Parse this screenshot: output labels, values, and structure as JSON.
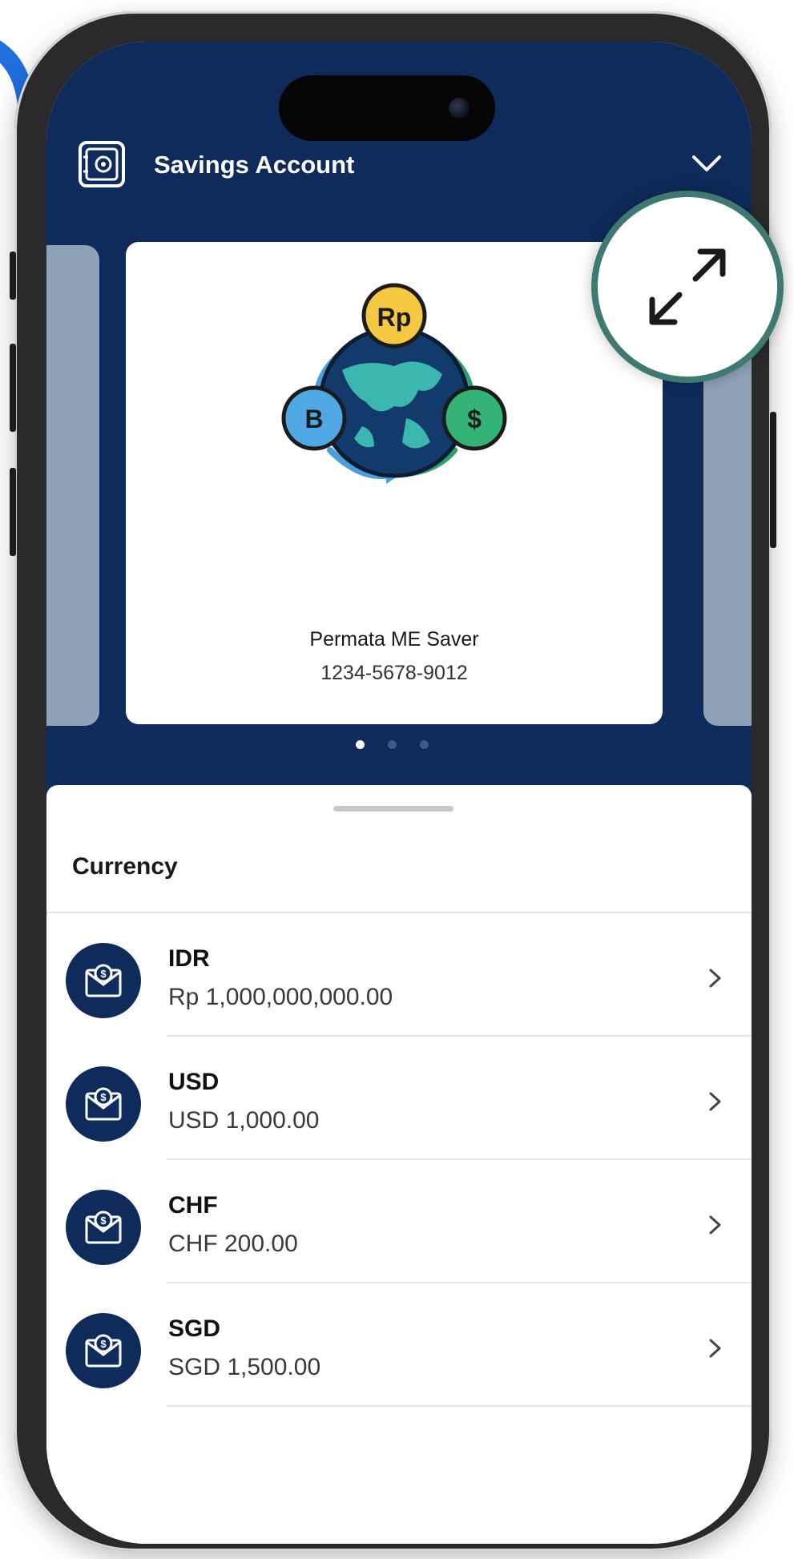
{
  "header": {
    "title": "Savings Account"
  },
  "card": {
    "product_name": "Permata ME Saver",
    "account_number": "1234-5678-9012",
    "illustration_coins": {
      "top": "Rp",
      "left": "B",
      "right": "$"
    }
  },
  "pagination": {
    "total": 3,
    "active_index": 0
  },
  "sheet": {
    "section_title": "Currency",
    "currencies": [
      {
        "code": "IDR",
        "amount": "Rp 1,000,000,000.00",
        "icon": "money-envelope-icon"
      },
      {
        "code": "USD",
        "amount": "USD 1,000.00",
        "icon": "money-envelope-icon"
      },
      {
        "code": "CHF",
        "amount": "CHF 200.00",
        "icon": "money-envelope-icon"
      },
      {
        "code": "SGD",
        "amount": "SGD 1,500.00",
        "icon": "money-envelope-icon"
      }
    ]
  },
  "colors": {
    "header_navy": "#0f2b5b",
    "expand_ring": "#3f7a72",
    "side_card": "#8fa2b8"
  },
  "icons": {
    "header_left": "safe-vault-icon",
    "header_right": "chevron-down-icon",
    "row_trailing": "chevron-right-icon",
    "callout": "expand-arrows-icon"
  }
}
